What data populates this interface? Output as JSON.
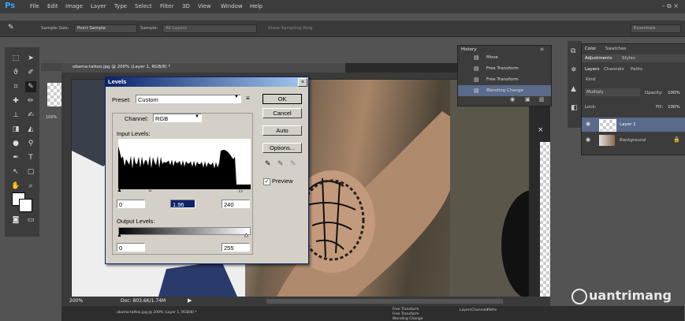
{
  "app": {
    "logo": "Ps",
    "window_controls": "– ⧉ ×"
  },
  "menu": [
    "File",
    "Edit",
    "Image",
    "Layer",
    "Type",
    "Select",
    "Filter",
    "3D",
    "View",
    "Window",
    "Help"
  ],
  "options_bar": {
    "sample_size_label": "Sample Size:",
    "sample_size_value": "Point Sample",
    "sample_label": "Sample:",
    "sample_value": "All Layers",
    "show_sampling_ring": "Show Sampling Ring",
    "workspace": "Essentials"
  },
  "document": {
    "tab_title": "obama-tattoo.jpg @ 200% (Layer 1, RGB/8) *",
    "zoom": "200%",
    "doc_size": "Doc: 803.6K/1.74M",
    "dock_title": "obama-tattoo.jpg @ 200% (Layer 1, RGB/8) *",
    "thumb_zoom": "100%"
  },
  "levels": {
    "title": "Levels",
    "close": "×",
    "preset_label": "Preset:",
    "preset_value": "Custom",
    "channel_label": "Channel:",
    "channel_value": "RGB",
    "input_label": "Input Levels:",
    "input_black": "0",
    "input_gamma": "1.96",
    "input_white": "240",
    "output_label": "Output Levels:",
    "output_black": "0",
    "output_white": "255",
    "ok": "OK",
    "cancel": "Cancel",
    "auto": "Auto",
    "options": "Options...",
    "preview": "Preview",
    "preview_checked": true
  },
  "history": {
    "title": "History",
    "items": [
      "Move",
      "Free Transform",
      "Free Transform",
      "Blending Change"
    ],
    "selected_index": 3
  },
  "right_panel": {
    "tabs_top": [
      "Color",
      "Swatches"
    ],
    "tabs_mid": [
      "Adjustments",
      "Styles"
    ],
    "tabs_layers": [
      "Layers",
      "Channels",
      "Paths"
    ],
    "kind_label": "Kind",
    "blend_mode": "Multiply",
    "opacity_label": "Opacity:",
    "opacity_value": "100%",
    "lock_label": "Lock:",
    "fill_label": "Fill:",
    "fill_value": "100%",
    "layers": [
      {
        "name": "Layer 1"
      },
      {
        "name": "Background"
      }
    ]
  },
  "dock_panels": {
    "history_items": [
      "Free Transform",
      "Free Transform",
      "Blending Change"
    ],
    "tabs": [
      "Layers",
      "Channels",
      "Paths"
    ]
  },
  "watermark": "uantrimang"
}
